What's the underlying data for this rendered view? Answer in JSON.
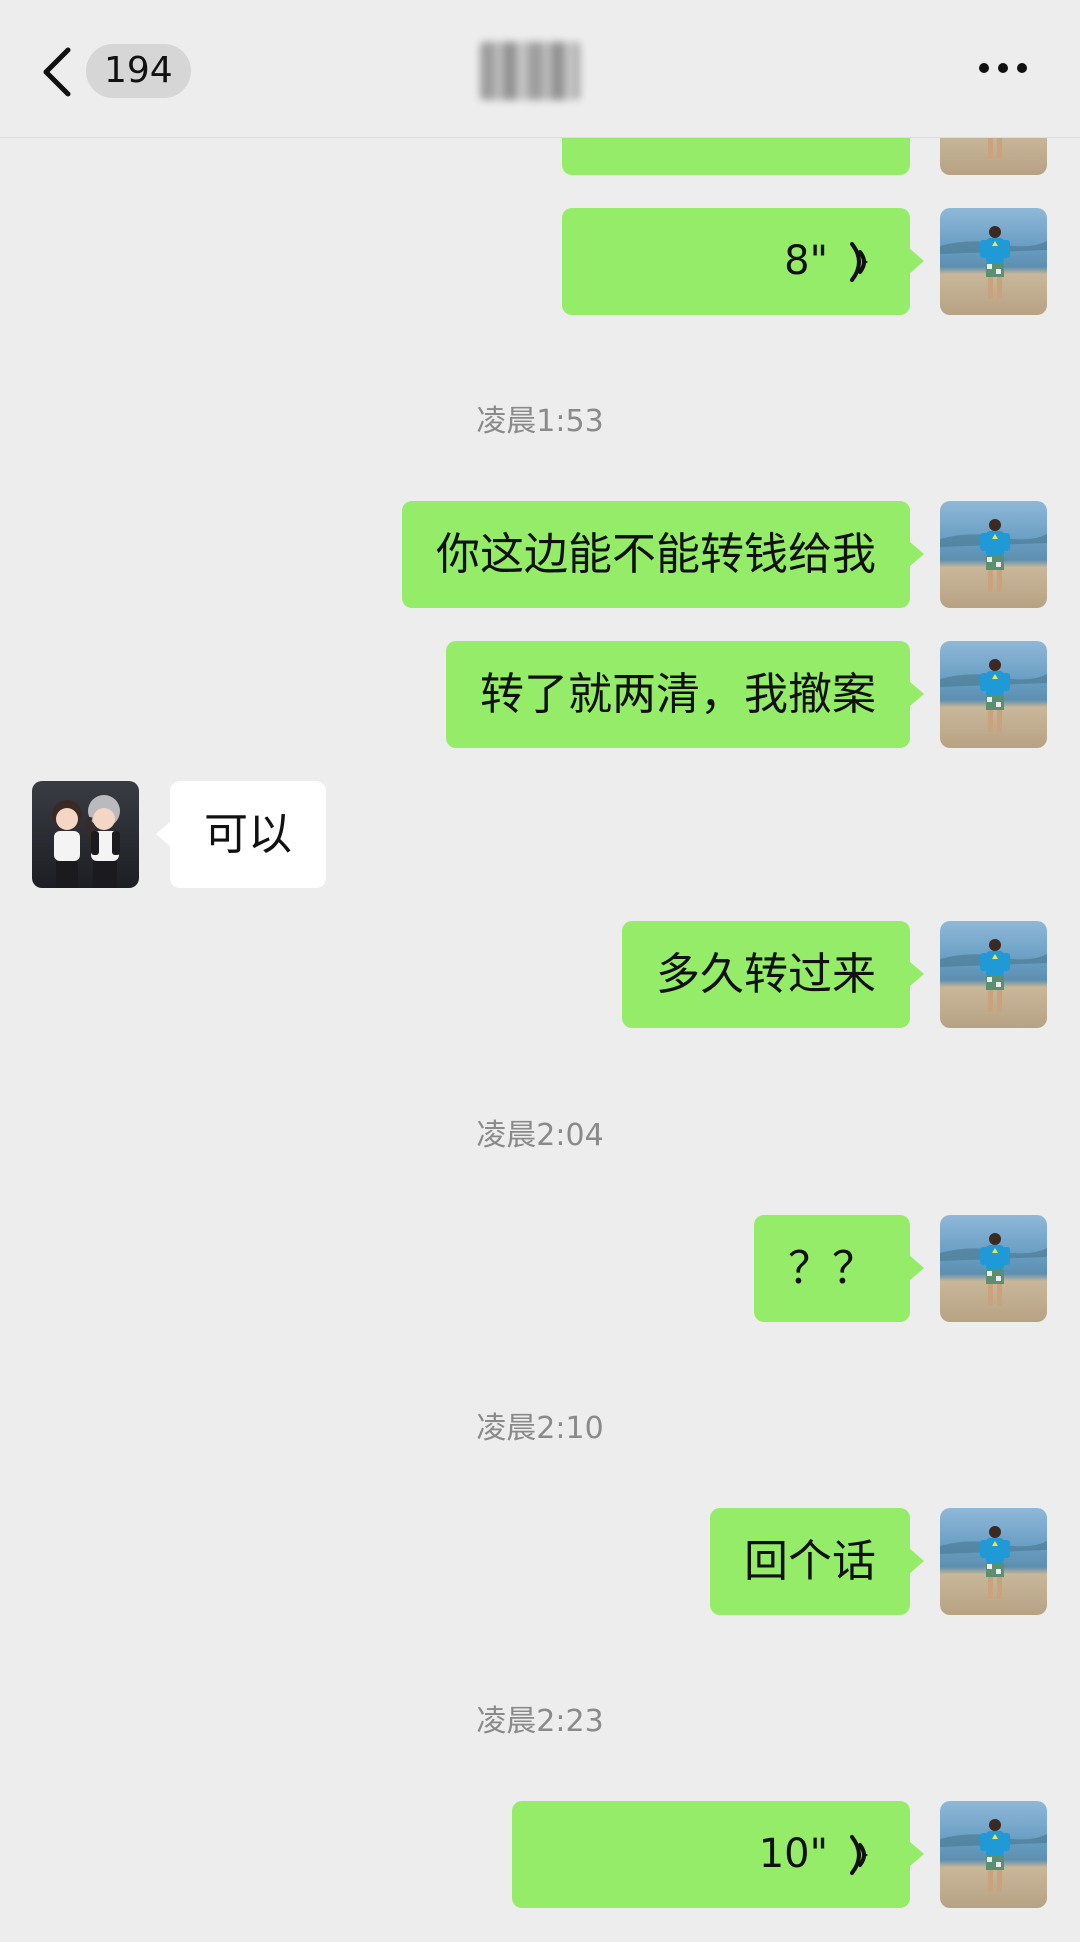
{
  "header": {
    "back_count": "194"
  },
  "colors": {
    "background": "#ededed",
    "bubble_me": "#95ec69",
    "bubble_other": "#ffffff",
    "timestamp": "#8a8a8a"
  },
  "icons": {
    "back": "chevron-left-icon",
    "more": "more-dots-icon",
    "voice": "voice-wave-icon"
  },
  "messages": {
    "m0": {
      "type": "voice",
      "sender": "me",
      "duration": ""
    },
    "m1": {
      "type": "voice",
      "sender": "me",
      "duration": "8\""
    },
    "t1": "凌晨1:53",
    "m2": {
      "type": "text",
      "sender": "me",
      "text": "你这边能不能转钱给我"
    },
    "m3": {
      "type": "text",
      "sender": "me",
      "text": "转了就两清，我撤案"
    },
    "m4": {
      "type": "text",
      "sender": "other",
      "text": "可以"
    },
    "m5": {
      "type": "text",
      "sender": "me",
      "text": "多久转过来"
    },
    "t2": "凌晨2:04",
    "m6": {
      "type": "text",
      "sender": "me",
      "text": "？？"
    },
    "t3": "凌晨2:10",
    "m7": {
      "type": "text",
      "sender": "me",
      "text": "回个话"
    },
    "t4": "凌晨2:23",
    "m8": {
      "type": "voice",
      "sender": "me",
      "duration": "10\""
    }
  }
}
